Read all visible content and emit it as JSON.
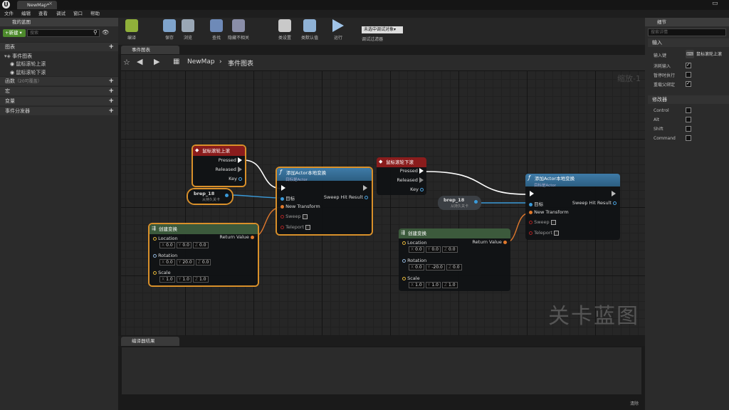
{
  "titlebar": {
    "logo": "U",
    "tab": "NewMap*",
    "close": "×",
    "window_btn": "▭"
  },
  "menubar": [
    "文件",
    "编辑",
    "查看",
    "调试",
    "窗口",
    "帮助"
  ],
  "left": {
    "header": "我的蓝图",
    "new_label": "+新建 ▾",
    "search_placeholder": "搜索",
    "graphs_label": "图表",
    "event_graph": "事件图表",
    "event_items": [
      "鼠标滚轮上滚",
      "鼠标滚轮下滚"
    ],
    "functions": "函数",
    "functions_note": "（20可覆盖）",
    "macros": "宏",
    "variables": "变量",
    "dispatchers": "事件分发器"
  },
  "toolbar": {
    "buttons": [
      {
        "label": "编译",
        "icon": "gear-icon",
        "color": "#8fb03a"
      },
      {
        "label": "保存",
        "icon": "save-icon",
        "color": "#7fa4cc"
      },
      {
        "label": "浏览",
        "icon": "browse-icon",
        "color": "#9aa7b5"
      },
      {
        "label": "查找",
        "icon": "find-icon",
        "color": "#6e8ab8"
      },
      {
        "label": "隐藏不相关",
        "icon": "hide-icon",
        "color": "#8a8ea8"
      },
      {
        "label": "类设置",
        "icon": "class-settings-icon",
        "color": "#c9c9c9"
      },
      {
        "label": "类默认值",
        "icon": "class-defaults-icon",
        "color": "#8fb2d6"
      },
      {
        "label": "运行",
        "icon": "play-icon",
        "color": "#9fc3e8"
      }
    ],
    "debug_select": "未选中调试对象▾",
    "debug_filter": "调试过滤器"
  },
  "graph": {
    "tab": "事件图表",
    "breadcrumb_root": "NewMap",
    "breadcrumb_sep": "›",
    "breadcrumb_current": "事件图表",
    "zoom": "缩放-1",
    "watermark": "关卡蓝图",
    "nodes": {
      "wheel_up": {
        "title": "鼠标滚轮上滚",
        "pins": [
          "Pressed",
          "Released",
          "Key"
        ]
      },
      "wheel_down": {
        "title": "鼠标滚轮下滚",
        "pins": [
          "Pressed",
          "Released",
          "Key"
        ]
      },
      "ref1": {
        "title": "brep_18",
        "sub": "从持久关卡"
      },
      "ref2": {
        "title": "brep_18",
        "sub": "从持久关卡"
      },
      "add1": {
        "title": "添加Actor本地变换",
        "sub": "目标是Actor",
        "target": "目标",
        "new_transform": "New Transform",
        "sweep": "Sweep",
        "teleport": "Teleport",
        "sweep_result": "Sweep Hit Result"
      },
      "add2": {
        "title": "添加Actor本地变换",
        "sub": "目标是Actor",
        "target": "目标",
        "new_transform": "New Transform",
        "sweep": "Sweep",
        "teleport": "Teleport",
        "sweep_result": "Sweep Hit Result"
      },
      "make1": {
        "title": "创建变换",
        "return": "Return Value",
        "location": "Location",
        "rotation": "Rotation",
        "scale": "Scale",
        "ax": "X",
        "ay": "Y",
        "az": "Z",
        "loc": [
          "0.0",
          "0.0",
          "0.0"
        ],
        "rot": [
          "0.0",
          "20.0",
          "0.0"
        ],
        "scl": [
          "1.0",
          "1.0",
          "1.0"
        ]
      },
      "make2": {
        "title": "创建变换",
        "return": "Return Value",
        "location": "Location",
        "rotation": "Rotation",
        "scale": "Scale",
        "ax": "X",
        "ay": "Y",
        "az": "Z",
        "loc": [
          "0.0",
          "0.0",
          "0.0"
        ],
        "rot": [
          "0.0",
          "-20.0",
          "0.0"
        ],
        "scl": [
          "1.0",
          "1.0",
          "1.0"
        ]
      }
    }
  },
  "bottom": {
    "tab": "编译器结果",
    "clear": "清除"
  },
  "right": {
    "header": "细节",
    "search_placeholder": "搜索详情",
    "input_section": "输入",
    "input_key_label": "输入键",
    "input_key_value": "鼠标滚轮上滚",
    "consume_input": "消耗输入",
    "execute_paused": "暂停时执行",
    "override_parent": "重载父绑定",
    "modifiers_section": "修改器",
    "modifiers": [
      "Control",
      "Alt",
      "Shift",
      "Command"
    ],
    "checks": {
      "consume_input": true,
      "execute_paused": false,
      "override_parent": true
    }
  },
  "colors": {
    "event_red": "#8a1c1c",
    "function_blue": "#2d5f82",
    "struct_green": "#3c5a3c",
    "exec_wire": "#ffffff",
    "object_wire": "#3a9ad9",
    "transform_wire": "#e0782c"
  }
}
